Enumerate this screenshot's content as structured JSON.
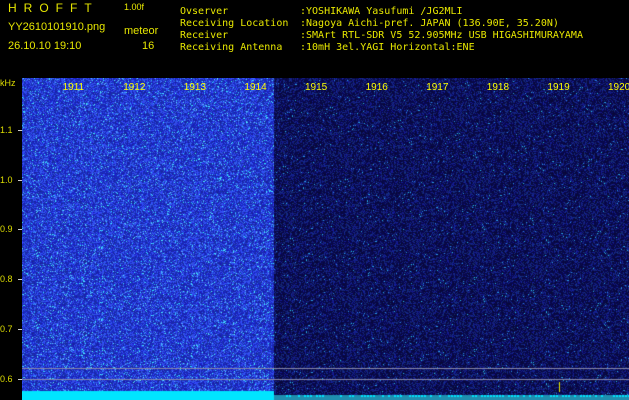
{
  "header": {
    "app_name": "HROFFT",
    "version": "1.00f",
    "filename": "YY2610101910.png",
    "event_label": "meteor",
    "datetime": "26.10.10 19:10",
    "count": "16",
    "meta": [
      {
        "key": "Ovserver",
        "value": ":YOSHIKAWA Yasufumi /JG2MLI"
      },
      {
        "key": "Receiving Location",
        "value": ":Nagoya Aichi-pref. JAPAN (136.90E, 35.20N)"
      },
      {
        "key": "Receiver",
        "value": ":SMArt RTL-SDR V5 52.905MHz USB HIGASHIMURAYAMA"
      },
      {
        "key": "Receiving Antenna",
        "value": ":10mH 3el.YAGI Horizontal:ENE"
      }
    ]
  },
  "chart_data": {
    "type": "heatmap",
    "ylabel": "kHz",
    "y_ticks": [
      "1.1",
      "1.0",
      "0.9",
      "0.8",
      "0.7",
      "0.6"
    ],
    "x_ticks": [
      "1911",
      "1912",
      "1913",
      "1914",
      "1915",
      "1916",
      "1917",
      "1918",
      "1919",
      "1920"
    ],
    "x_unit": "minute (HHMM)",
    "y_range": [
      0.575,
      1.2
    ],
    "bright_region_x": [
      1910,
      1914.1
    ],
    "reference_lines_khz": [
      0.62,
      0.598
    ],
    "colors": {
      "bright_bg": "#2626c8",
      "dim_bg": "#0d0d4a",
      "carrier": "#00e5ff",
      "speckle": "#40c0ff"
    }
  }
}
